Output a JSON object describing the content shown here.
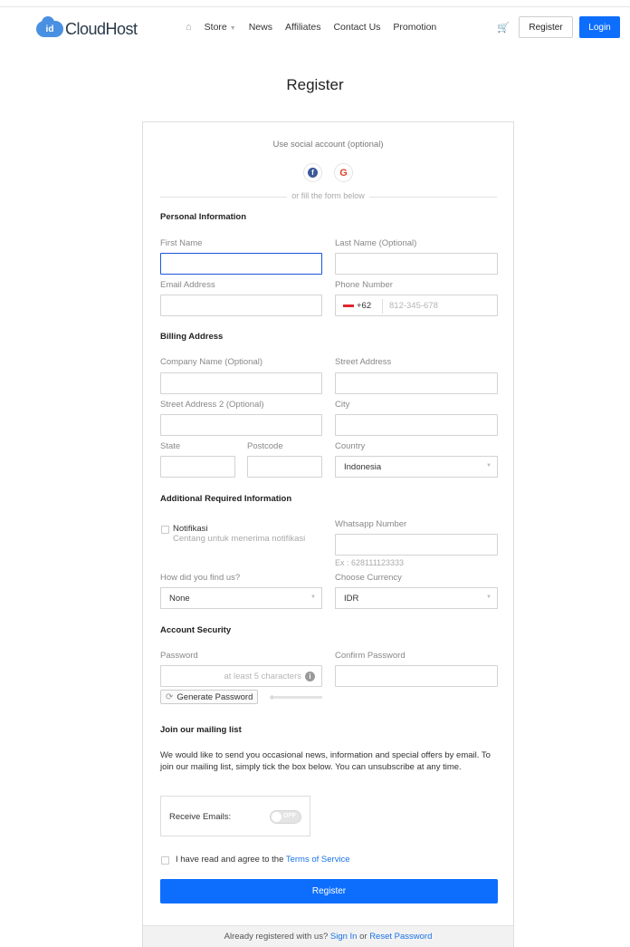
{
  "brand": {
    "badge": "id",
    "name": "CloudHost"
  },
  "nav": {
    "home_icon": "home-icon",
    "items": [
      {
        "label": "Store",
        "dropdown": true
      },
      {
        "label": "News"
      },
      {
        "label": "Affiliates"
      },
      {
        "label": "Contact Us"
      },
      {
        "label": "Promotion"
      }
    ],
    "cart_icon": "cart-icon",
    "register_label": "Register",
    "login_label": "Login"
  },
  "page": {
    "title": "Register"
  },
  "social": {
    "title": "Use social account (optional)",
    "facebook_icon": "facebook-icon",
    "google_label": "G",
    "divider": "or fill the form below"
  },
  "personal": {
    "heading": "Personal Information",
    "first_name": {
      "label": "First Name",
      "value": ""
    },
    "last_name": {
      "label": "Last Name (Optional)",
      "value": ""
    },
    "email": {
      "label": "Email Address",
      "value": ""
    },
    "phone": {
      "label": "Phone Number",
      "code": "+62",
      "placeholder": "812-345-678"
    }
  },
  "billing": {
    "heading": "Billing Address",
    "company": {
      "label": "Company Name (Optional)"
    },
    "street": {
      "label": "Street Address"
    },
    "street2": {
      "label": "Street Address 2 (Optional)"
    },
    "city": {
      "label": "City"
    },
    "state": {
      "label": "State"
    },
    "postcode": {
      "label": "Postcode"
    },
    "country": {
      "label": "Country",
      "value": "Indonesia"
    }
  },
  "additional": {
    "heading": "Additional Required Information",
    "notif_label": "Notifikasi",
    "notif_desc": "Centang untuk menerima notifikasi",
    "whatsapp": {
      "label": "Whatsapp Number",
      "hint": "Ex : 628111123333"
    },
    "found_us": {
      "label": "How did you find us?",
      "value": "None"
    },
    "currency": {
      "label": "Choose Currency",
      "value": "IDR"
    }
  },
  "security": {
    "heading": "Account Security",
    "password": {
      "label": "Password",
      "placeholder": "at least 5 characters"
    },
    "confirm": {
      "label": "Confirm Password"
    },
    "generate_label": "Generate Password"
  },
  "mailing": {
    "heading": "Join our mailing list",
    "text": "We would like to send you occasional news, information and special offers by email. To join our mailing list, simply tick the box below. You can unsubscribe at any time.",
    "receive_label": "Receive Emails:",
    "toggle_text": "OFF"
  },
  "terms": {
    "prefix": "I have read and agree to the",
    "link": "Terms of Service"
  },
  "submit_label": "Register",
  "footer": {
    "prefix": "Already registered with us?",
    "signin": "Sign In",
    "or": "or",
    "reset": "Reset Password"
  }
}
